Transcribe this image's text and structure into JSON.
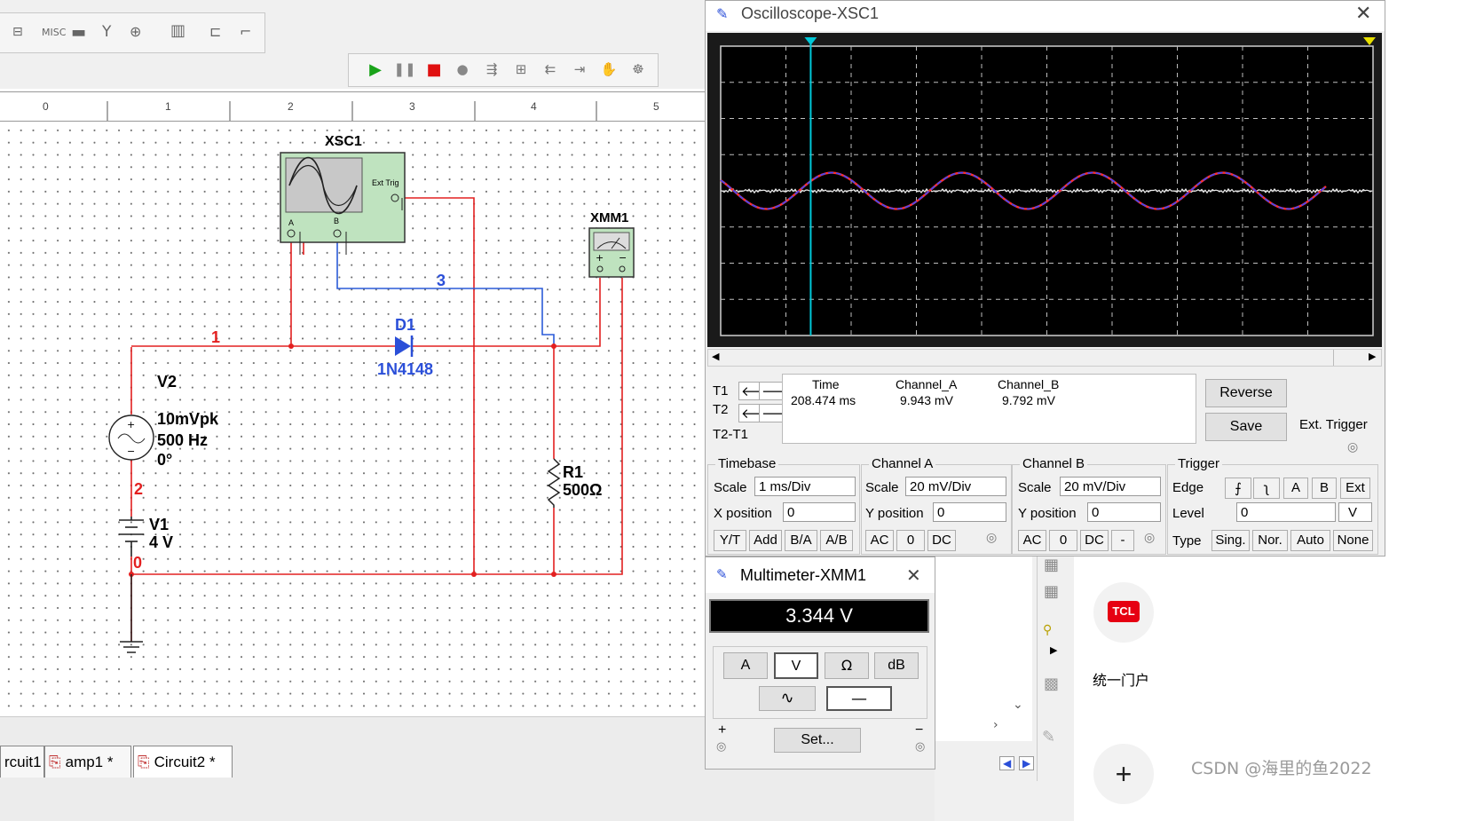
{
  "schematic": {
    "ruler_ticks": [
      "0",
      "1",
      "2",
      "3",
      "4",
      "5"
    ],
    "tabs": [
      "rcuit1",
      "amp1 *",
      "Circuit2 *"
    ],
    "components": {
      "oscilloscope_ref": "XSC1",
      "ext_trig_label": "Ext Trig",
      "port_a": "A",
      "port_b": "B",
      "multimeter_ref": "XMM1",
      "diode_ref": "D1",
      "diode_model": "1N4148",
      "source_ref": "V2",
      "source_amp": "10mVpk",
      "source_freq": "500 Hz",
      "source_phase": "0°",
      "battery_ref": "V1",
      "battery_value": "4 V",
      "resistor_ref": "R1",
      "resistor_value": "500Ω"
    },
    "nets": [
      "1",
      "2",
      "3",
      "0"
    ]
  },
  "toolbar": {
    "icons": [
      "breadboard-icon",
      "misc-icon",
      "board-icon",
      "antenna-icon",
      "module-icon",
      "bus-icon",
      "hierarchy-icon",
      "step-icon"
    ],
    "sim_icons": [
      "run-icon",
      "pause-icon",
      "stop-icon",
      "record-icon",
      "probe-icon",
      "grapher-icon",
      "postprocessor-icon",
      "export-icon",
      "hand-icon",
      "interactive-icon"
    ],
    "misc_label": "MISC"
  },
  "oscilloscope": {
    "title": "Oscilloscope-XSC1",
    "readout_labels": {
      "t1": "T1",
      "t2": "T2",
      "t2t1": "T2-T1"
    },
    "readout_headers": {
      "time": "Time",
      "chA": "Channel_A",
      "chB": "Channel_B"
    },
    "t1_values": {
      "time": "208.474 ms",
      "chA": "9.943 mV",
      "chB": "9.792 mV"
    },
    "buttons": {
      "reverse": "Reverse",
      "save": "Save"
    },
    "ext_trigger": "Ext. Trigger",
    "timebase": {
      "title": "Timebase",
      "scale_label": "Scale",
      "scale": "1 ms/Div",
      "xpos_label": "X position",
      "xpos": "0",
      "modes": [
        "Y/T",
        "Add",
        "B/A",
        "A/B"
      ]
    },
    "channel_a": {
      "title": "Channel A",
      "scale_label": "Scale",
      "scale": "20 mV/Div",
      "ypos_label": "Y position",
      "ypos": "0",
      "coupling": [
        "AC",
        "0",
        "DC"
      ]
    },
    "channel_b": {
      "title": "Channel B",
      "scale_label": "Scale",
      "scale": "20 mV/Div",
      "ypos_label": "Y position",
      "ypos": "0",
      "coupling": [
        "AC",
        "0",
        "DC",
        "-"
      ]
    },
    "trigger": {
      "title": "Trigger",
      "edge_label": "Edge",
      "edge_buttons": [
        "A",
        "B",
        "Ext"
      ],
      "level_label": "Level",
      "level": "0",
      "level_unit": "V",
      "type_label": "Type",
      "types": [
        "Sing.",
        "Nor.",
        "Auto",
        "None"
      ]
    },
    "colors": {
      "screen": "#000000",
      "channel_a": "#ff3030",
      "channel_b": "#3a48ff",
      "cursor": "#00c8d8"
    }
  },
  "chart_data": {
    "type": "line",
    "xlabel": "",
    "ylabel": "",
    "grid": true,
    "x_divisions": 10,
    "y_divisions": 8,
    "series": [
      {
        "name": "Channel A",
        "color": "#ff3030",
        "amplitude_div": 0.5,
        "period_div": 2.0,
        "phase": 0.1
      },
      {
        "name": "Channel B",
        "color": "#3a48ff",
        "amplitude_div": 0.5,
        "period_div": 2.0,
        "phase": 0.1
      }
    ]
  },
  "multimeter": {
    "title": "Multimeter-XMM1",
    "reading": "3.344 V",
    "mode_buttons": [
      "A",
      "V",
      "Ω",
      "dB"
    ],
    "set_label": "Set...",
    "plus": "+",
    "minus": "−"
  },
  "right_panel": {
    "tcl_logo": "TCL",
    "portal_label": "统一门户",
    "plus": "+",
    "watermark": "CSDN @海里的鱼2022"
  }
}
